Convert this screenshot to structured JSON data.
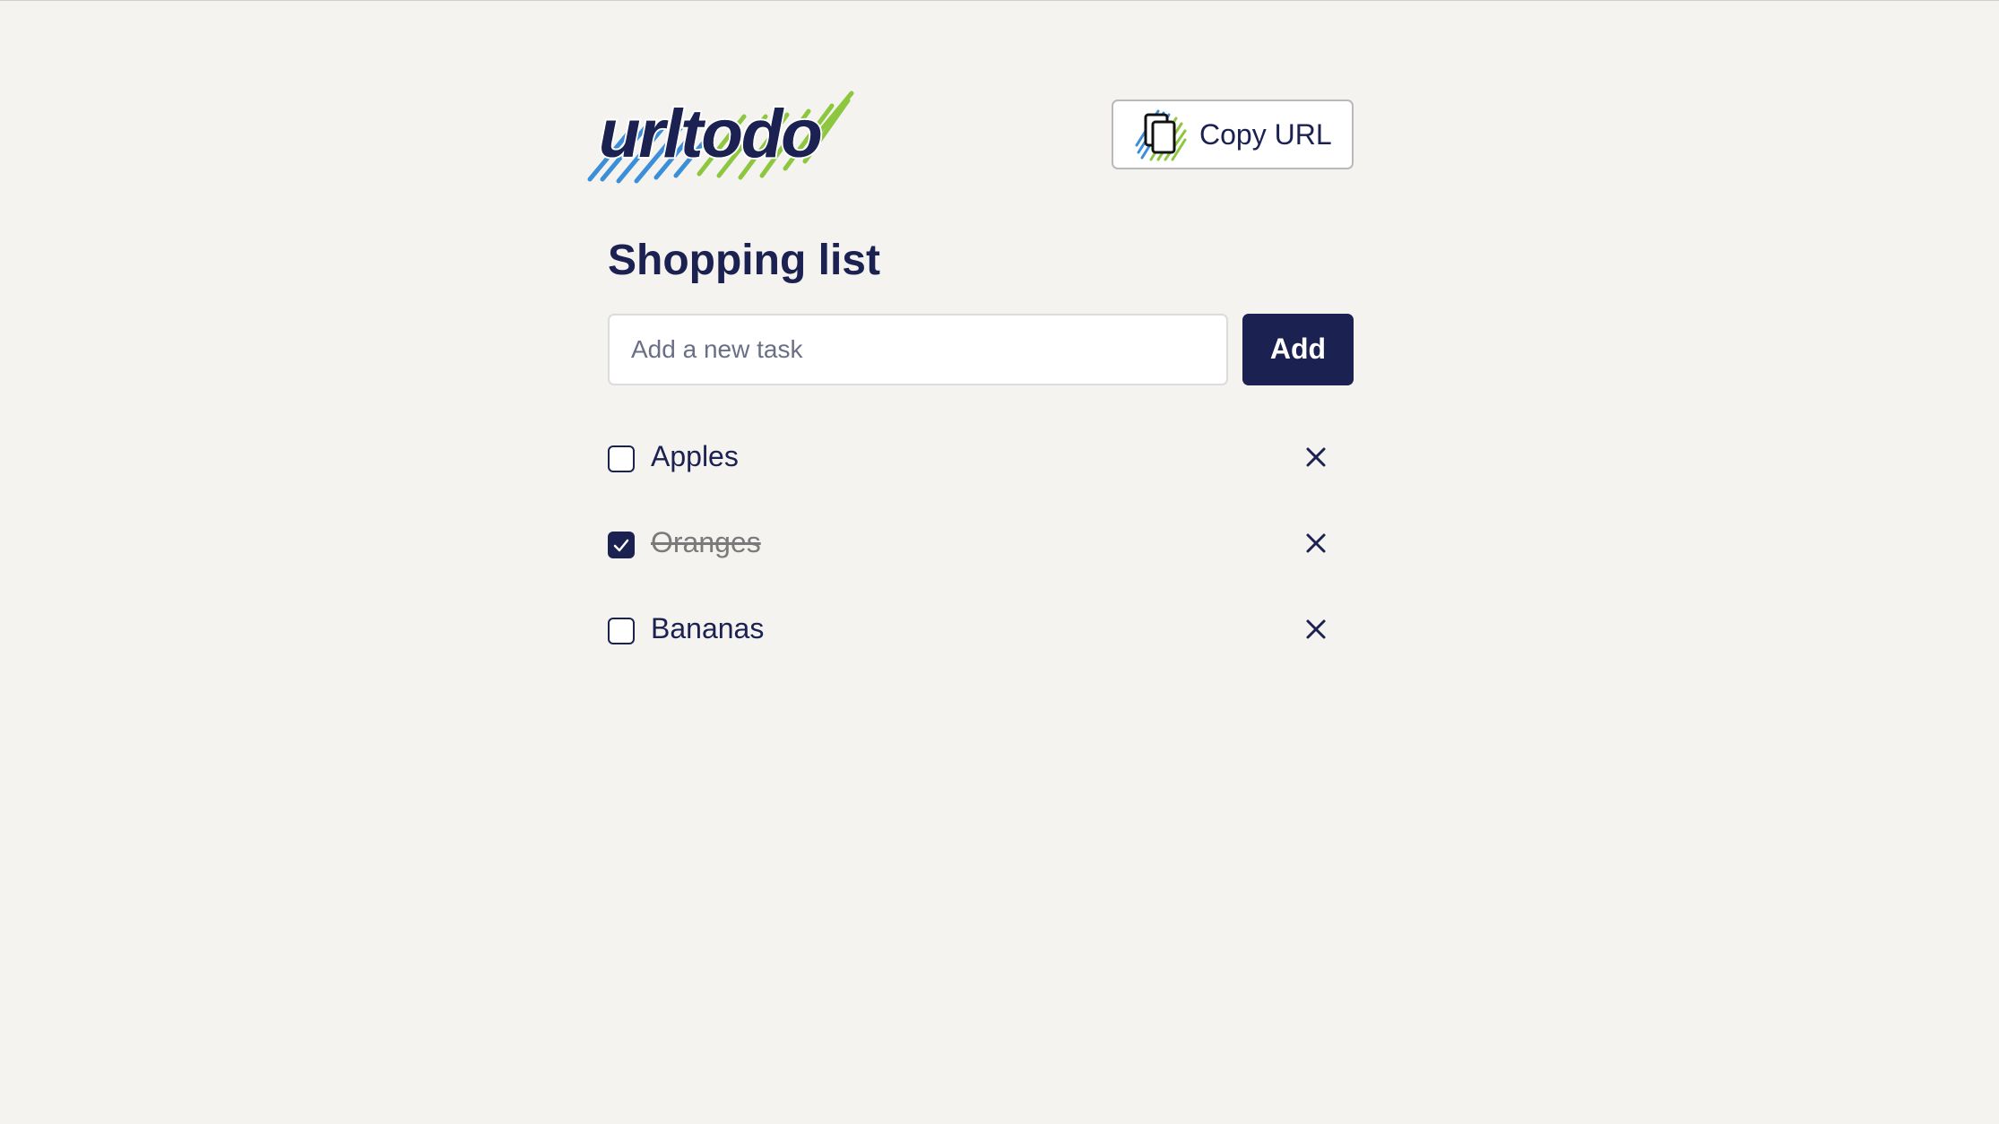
{
  "app": {
    "logo_text": "urltodo",
    "copy_button_label": "Copy URL",
    "copy_icon": "copy-icon"
  },
  "list": {
    "title": "Shopping list"
  },
  "new_task": {
    "placeholder": "Add a new task",
    "value": "",
    "add_label": "Add"
  },
  "tasks": [
    {
      "label": "Apples",
      "done": false
    },
    {
      "label": "Oranges",
      "done": true
    },
    {
      "label": "Bananas",
      "done": false
    }
  ],
  "colors": {
    "primary": "#1b2150",
    "background": "#f4f3f0",
    "accent_blue": "#3b8fd9",
    "accent_green": "#8dc63f"
  }
}
